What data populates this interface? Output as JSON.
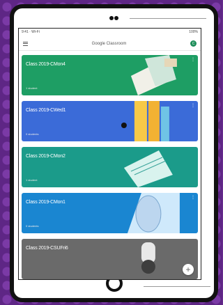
{
  "status": {
    "left": "9:41 · Wi-Fi",
    "right": "100%"
  },
  "app": {
    "title": "Google Classroom",
    "avatar": "C"
  },
  "cards": [
    {
      "title": "Class 2019-CMon4",
      "subtitle": "1 student",
      "color": "#1e9e64"
    },
    {
      "title": "Class 2019-CWed1",
      "subtitle": "0 students",
      "color": "#3b6bd8"
    },
    {
      "title": "Class 2019-CMon2",
      "subtitle": "1 student",
      "color": "#1b9b8a"
    },
    {
      "title": "Class 2019-CMon1",
      "subtitle": "0 students",
      "color": "#1a86d1"
    },
    {
      "title": "Class 2019-CSUFri6",
      "subtitle": "",
      "color": "#6a6a6a"
    }
  ],
  "fab": {
    "label": "+"
  }
}
